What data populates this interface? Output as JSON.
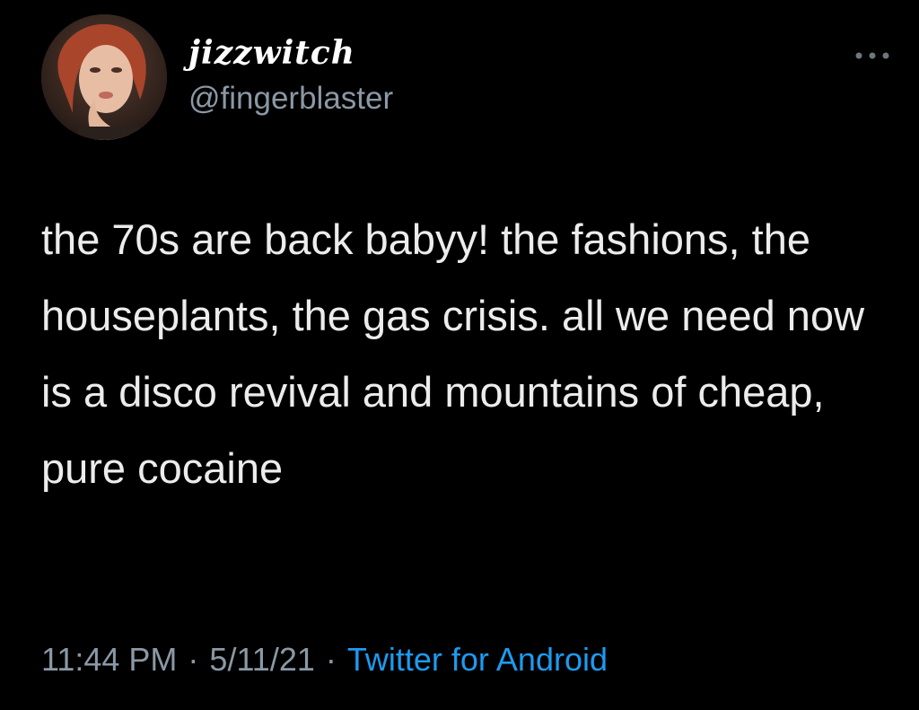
{
  "tweet": {
    "author": {
      "display_name": "jizzwitch",
      "handle": "@fingerblaster",
      "avatar_icon": "profile-photo"
    },
    "text": "the 70s are back babyy! the fashions, the houseplants, the gas crisis. all we need now is a disco revival and mountains of cheap, pure cocaine",
    "time": "11:44 PM",
    "date": "5/11/21",
    "separator": "·",
    "source": "Twitter for Android",
    "more_icon": "ellipsis-icon"
  },
  "colors": {
    "background": "#000000",
    "text": "#ececec",
    "secondary": "#8b98a5",
    "link": "#1d9bf0"
  }
}
